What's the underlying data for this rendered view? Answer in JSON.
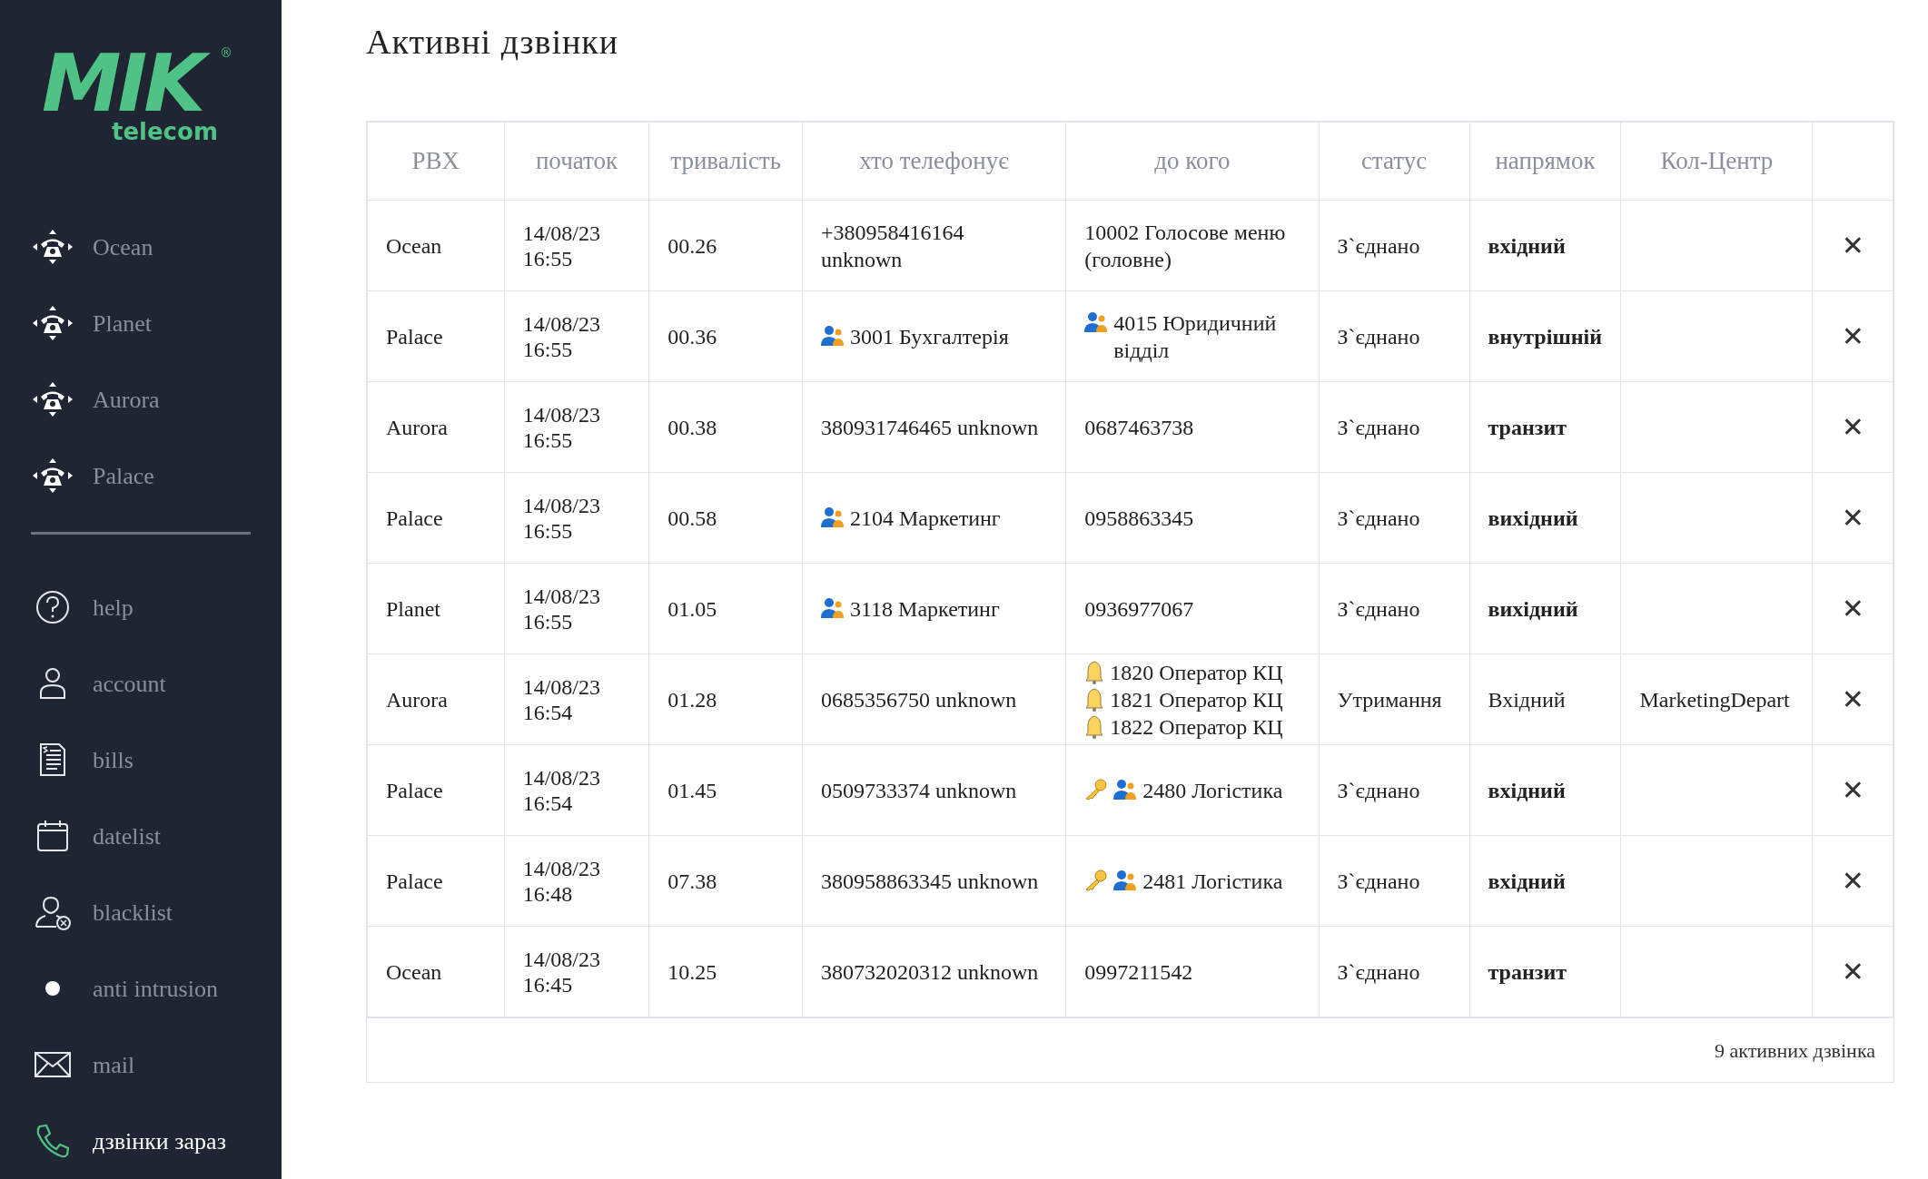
{
  "logo": {
    "main": "MIK",
    "sub": "telecom",
    "mark": "®"
  },
  "sidebar": {
    "pbx_items": [
      {
        "label": "Ocean",
        "selected": false
      },
      {
        "label": "Planet",
        "selected": false
      },
      {
        "label": "Aurora",
        "selected": false
      },
      {
        "label": "Palace",
        "selected": false
      }
    ],
    "menu_items": [
      {
        "kind": "help",
        "label": "help",
        "selected": false
      },
      {
        "kind": "account",
        "label": "account",
        "selected": false
      },
      {
        "kind": "bills",
        "label": "bills",
        "selected": false
      },
      {
        "kind": "datelist",
        "label": "datelist",
        "selected": false
      },
      {
        "kind": "blacklist",
        "label": "blacklist",
        "selected": false
      },
      {
        "kind": "dot",
        "label": "anti intrusion",
        "selected": false
      },
      {
        "kind": "mail",
        "label": "mail",
        "selected": false
      },
      {
        "kind": "phone",
        "label": "дзвінки зараз",
        "selected": true
      }
    ]
  },
  "title": "Активні дзвінки",
  "table": {
    "columns": [
      "PBX",
      "початок",
      "тривалість",
      "хто телефонує",
      "до кого",
      "статус",
      "напрямок",
      "Кол-Центр"
    ],
    "rows": [
      {
        "pbx": "Ocean",
        "start": [
          "14/08/23",
          "16:55"
        ],
        "duration": "00.26",
        "caller": [
          {
            "kind": "plain",
            "text": "+380958416164 unknown"
          }
        ],
        "callee": [
          {
            "kind": "plain",
            "text": "10002 Голосове меню (головне)"
          }
        ],
        "status": "З`єднано",
        "direction": "вхідний",
        "direction_bold": true
      },
      {
        "pbx": "Palace",
        "start": [
          "14/08/23",
          "16:55"
        ],
        "duration": "00.36",
        "caller": [
          {
            "kind": "group",
            "text": "3001 Бухгалтерія"
          }
        ],
        "callee": [
          {
            "kind": "group",
            "text": "4015 Юридичний відділ"
          }
        ],
        "status": "З`єднано",
        "direction": "внутрішній",
        "direction_bold": true
      },
      {
        "pbx": "Aurora",
        "start": [
          "14/08/23",
          "16:55"
        ],
        "duration": "00.38",
        "caller": [
          {
            "kind": "plain",
            "text": "380931746465 unknown"
          }
        ],
        "callee": [
          {
            "kind": "plain",
            "text": "0687463738"
          }
        ],
        "status": "З`єднано",
        "direction": "транзит",
        "direction_bold": true
      },
      {
        "pbx": "Palace",
        "start": [
          "14/08/23",
          "16:55"
        ],
        "duration": "00.58",
        "caller": [
          {
            "kind": "group",
            "text": "2104 Маркетинг"
          }
        ],
        "callee": [
          {
            "kind": "plain",
            "text": "0958863345"
          }
        ],
        "status": "З`єднано",
        "direction": "вихідний",
        "direction_bold": true
      },
      {
        "pbx": "Planet",
        "start": [
          "14/08/23",
          "16:55"
        ],
        "duration": "01.05",
        "caller": [
          {
            "kind": "group",
            "text": "3118 Маркетинг"
          }
        ],
        "callee": [
          {
            "kind": "plain",
            "text": "0936977067"
          }
        ],
        "status": "З`єднано",
        "direction": "вихідний",
        "direction_bold": true
      },
      {
        "pbx": "Aurora",
        "start": [
          "14/08/23",
          "16:54"
        ],
        "duration": "01.28",
        "caller": [
          {
            "kind": "plain",
            "text": "0685356750 unknown"
          }
        ],
        "callee": [
          {
            "kind": "bell",
            "text": "1820 Оператор КЦ"
          },
          {
            "kind": "bell",
            "text": "1821 Оператор КЦ"
          },
          {
            "kind": "bell",
            "text": "1822 Оператор КЦ"
          }
        ],
        "status": "Утримання",
        "direction": "Вхідний",
        "direction_bold": false,
        "call_center": "MarketingDepart"
      },
      {
        "pbx": "Palace",
        "start": [
          "14/08/23",
          "16:54"
        ],
        "duration": "01.45",
        "caller": [
          {
            "kind": "plain",
            "text": "0509733374 unknown"
          }
        ],
        "callee": [
          {
            "kind": "key_group",
            "text": "2480 Логістика"
          }
        ],
        "status": "З`єднано",
        "direction": "вхідний",
        "direction_bold": true
      },
      {
        "pbx": "Palace",
        "start": [
          "14/08/23",
          "16:48"
        ],
        "duration": "07.38",
        "caller": [
          {
            "kind": "plain",
            "text": "380958863345 unknown"
          }
        ],
        "callee": [
          {
            "kind": "key_group",
            "text": "2481 Логістика"
          }
        ],
        "status": "З`єднано",
        "direction": "вхідний",
        "direction_bold": true
      },
      {
        "pbx": "Ocean",
        "start": [
          "14/08/23",
          "16:45"
        ],
        "duration": "10.25",
        "caller": [
          {
            "kind": "plain",
            "text": "380732020312 unknown"
          }
        ],
        "callee": [
          {
            "kind": "plain",
            "text": "0997211542"
          }
        ],
        "status": "З`єднано",
        "direction": "транзит",
        "direction_bold": true
      }
    ],
    "hangup_glyph": "✕",
    "footer": "9 активних дзвінка"
  }
}
